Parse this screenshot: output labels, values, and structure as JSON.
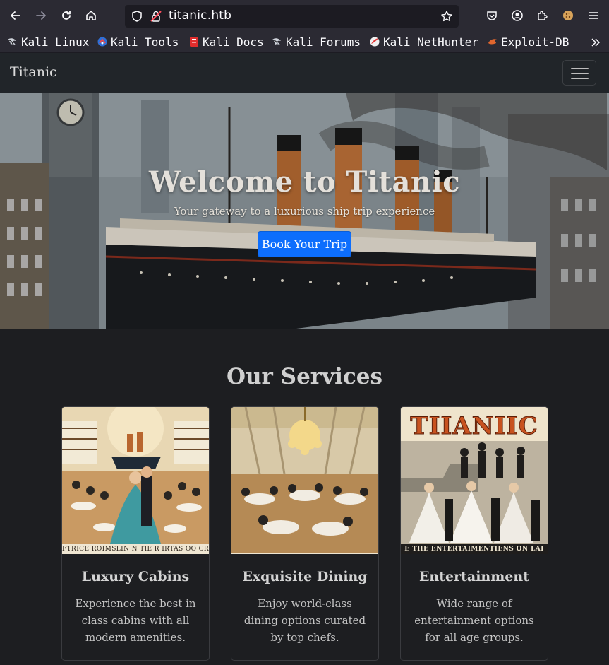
{
  "browser": {
    "url": "titanic.htb",
    "bookmarks": [
      {
        "label": "Kali Linux",
        "icon": "kali-dragon-icon"
      },
      {
        "label": "Kali Tools",
        "icon": "kali-tools-icon"
      },
      {
        "label": "Kali Docs",
        "icon": "kali-docs-icon"
      },
      {
        "label": "Kali Forums",
        "icon": "kali-dragon-icon"
      },
      {
        "label": "Kali NetHunter",
        "icon": "nethunter-icon"
      },
      {
        "label": "Exploit-DB",
        "icon": "exploit-db-icon"
      }
    ]
  },
  "navbar": {
    "brand": "Titanic"
  },
  "hero": {
    "title": "Welcome to Titanic",
    "subtitle": "Your gateway to a luxurious ship trip experience",
    "cta_label": "Book Your Trip"
  },
  "services": {
    "heading": "Our Services",
    "cards": [
      {
        "title": "Luxury Cabins",
        "text": "Experience the best in class cabins with all modern amenities.",
        "image_caption": "FTRICE ROIMSLIN N TIE R IRTAS OO CRAS I"
      },
      {
        "title": "Exquisite Dining",
        "text": "Enjoy world-class dining options curated by top chefs."
      },
      {
        "title": "Entertainment",
        "text": "Wide range of entertainment options for all age groups.",
        "image_banner": "TIIANIIC",
        "image_caption": "E THE ENTERTAIMENTIENS ON LAI"
      }
    ]
  },
  "colors": {
    "browser_toolbar": "#2b2a33",
    "navbar_bg": "#212529",
    "page_bg": "#1d1e21",
    "primary_button": "#0d6efd"
  }
}
